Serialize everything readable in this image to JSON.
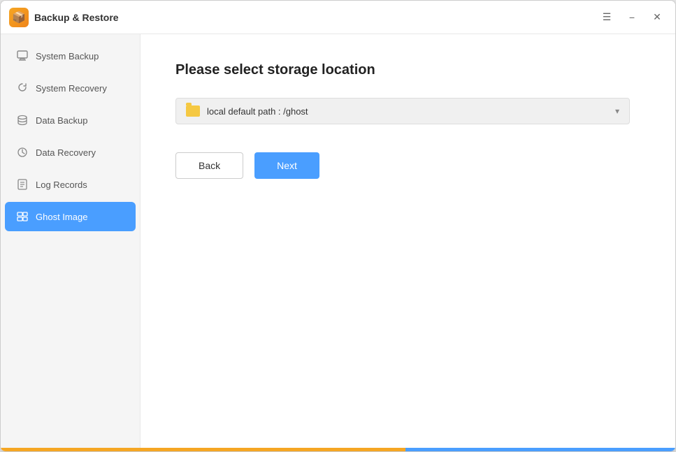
{
  "window": {
    "title": "Backup & Restore",
    "icon": "🗂️"
  },
  "titlebar": {
    "menu_icon": "☰",
    "minimize_label": "−",
    "close_label": "✕"
  },
  "sidebar": {
    "items": [
      {
        "id": "system-backup",
        "label": "System Backup",
        "active": false
      },
      {
        "id": "system-recovery",
        "label": "System Recovery",
        "active": false
      },
      {
        "id": "data-backup",
        "label": "Data Backup",
        "active": false
      },
      {
        "id": "data-recovery",
        "label": "Data Recovery",
        "active": false
      },
      {
        "id": "log-records",
        "label": "Log Records",
        "active": false
      },
      {
        "id": "ghost-image",
        "label": "Ghost Image",
        "active": true
      }
    ]
  },
  "content": {
    "page_title": "Please select storage location",
    "storage_path": "local default path : /ghost",
    "back_button": "Back",
    "next_button": "Next"
  }
}
